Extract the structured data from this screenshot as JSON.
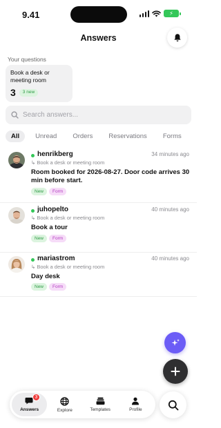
{
  "status_bar": {
    "time": "9.41",
    "battery": "⚡"
  },
  "header": {
    "title": "Answers"
  },
  "your_questions": {
    "label": "Your questions",
    "card": {
      "title": "Book a desk or meeting room",
      "count": "3",
      "badge": "3 new"
    }
  },
  "search": {
    "placeholder": "Search answers..."
  },
  "filters": [
    {
      "label": "All",
      "active": true
    },
    {
      "label": "Unread"
    },
    {
      "label": "Orders"
    },
    {
      "label": "Reservations"
    },
    {
      "label": "Forms"
    }
  ],
  "answers": [
    {
      "user": "henrikberg",
      "time": "34 minutes ago",
      "source": "Book a desk or meeting room",
      "message": "Room booked for 2026-08-27. Door code arrives 30 min before start.",
      "tags": [
        "New",
        "Form"
      ]
    },
    {
      "user": "juhopelto",
      "time": "40 minutes ago",
      "source": "Book a desk or meeting room",
      "message": "Book a tour",
      "tags": [
        "New",
        "Form"
      ]
    },
    {
      "user": "mariastrom",
      "time": "40 minutes ago",
      "source": "Book a desk or meeting room",
      "message": "Day desk",
      "tags": [
        "New",
        "Form"
      ]
    }
  ],
  "nav": {
    "items": [
      {
        "label": "Answers",
        "icon": "chat-icon",
        "badge": "3",
        "active": true
      },
      {
        "label": "Explore",
        "icon": "globe-icon"
      },
      {
        "label": "Templates",
        "icon": "stack-icon"
      },
      {
        "label": "Profile",
        "icon": "person-icon"
      }
    ]
  },
  "colors": {
    "accent": "#6b5cf6",
    "new_badge": "#2e9b45",
    "form_badge": "#b33cc0",
    "online": "#34c759",
    "badge_red": "#ef3b3b"
  }
}
